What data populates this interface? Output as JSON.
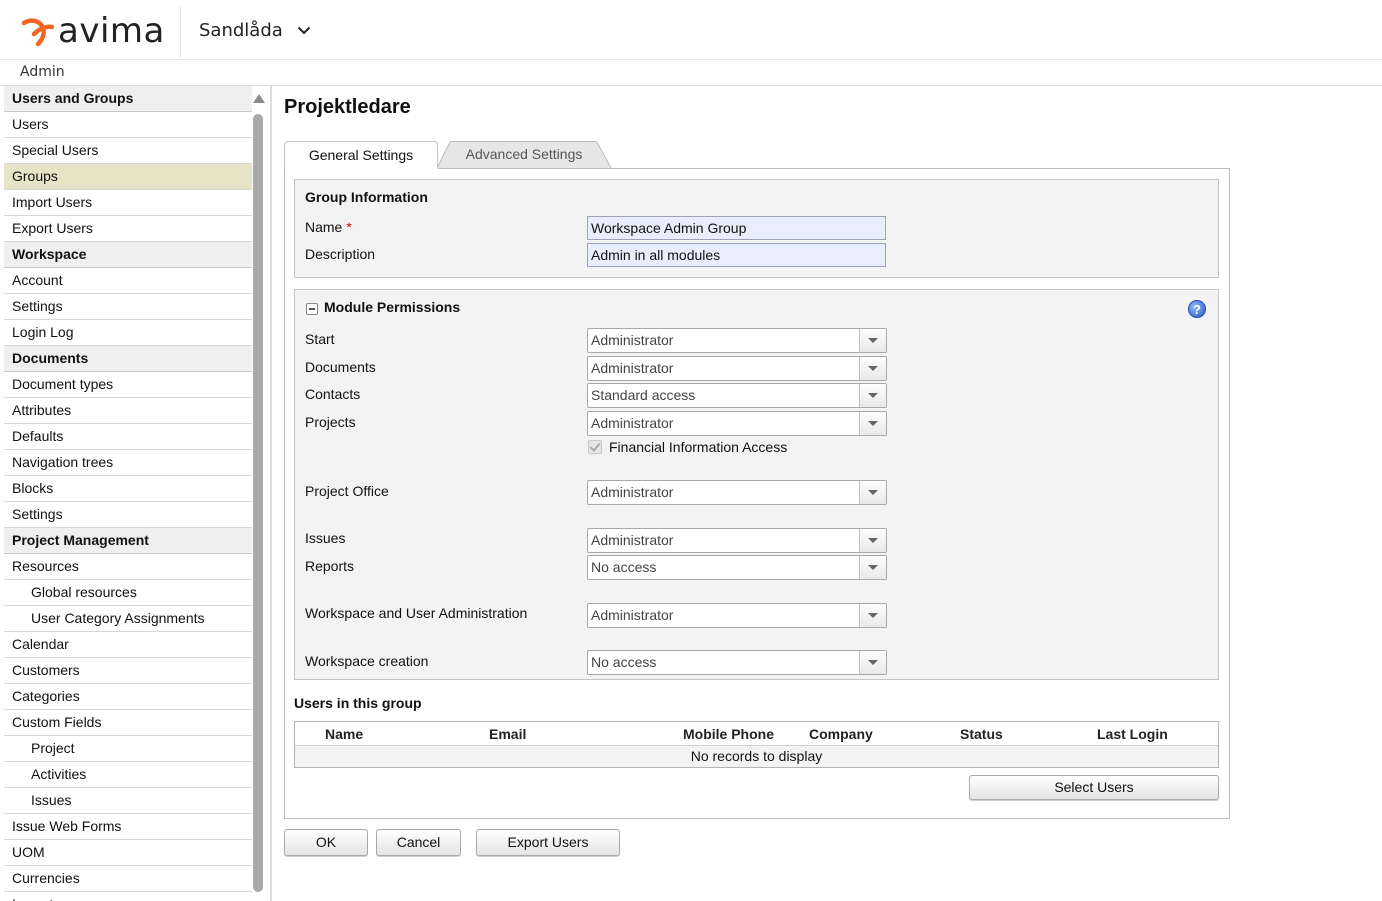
{
  "header": {
    "brand": "avima",
    "workspace": "Sandlåda",
    "breadcrumb": "Admin"
  },
  "sidebar": {
    "items": [
      {
        "label": "Users and Groups",
        "type": "header"
      },
      {
        "label": "Users",
        "type": "item"
      },
      {
        "label": "Special Users",
        "type": "item"
      },
      {
        "label": "Groups",
        "type": "item",
        "active": true
      },
      {
        "label": "Import Users",
        "type": "item"
      },
      {
        "label": "Export Users",
        "type": "item"
      },
      {
        "label": "Workspace",
        "type": "header"
      },
      {
        "label": "Account",
        "type": "item"
      },
      {
        "label": "Settings",
        "type": "item"
      },
      {
        "label": "Login Log",
        "type": "item"
      },
      {
        "label": "Documents",
        "type": "header"
      },
      {
        "label": "Document types",
        "type": "item"
      },
      {
        "label": "Attributes",
        "type": "item"
      },
      {
        "label": "Defaults",
        "type": "item"
      },
      {
        "label": "Navigation trees",
        "type": "item"
      },
      {
        "label": "Blocks",
        "type": "item"
      },
      {
        "label": "Settings",
        "type": "item"
      },
      {
        "label": "Project Management",
        "type": "header"
      },
      {
        "label": "Resources",
        "type": "item"
      },
      {
        "label": "Global resources",
        "type": "sub"
      },
      {
        "label": "User Category Assignments",
        "type": "sub"
      },
      {
        "label": "Calendar",
        "type": "item"
      },
      {
        "label": "Customers",
        "type": "item"
      },
      {
        "label": "Categories",
        "type": "item"
      },
      {
        "label": "Custom Fields",
        "type": "item"
      },
      {
        "label": "Project",
        "type": "sub"
      },
      {
        "label": "Activities",
        "type": "sub"
      },
      {
        "label": "Issues",
        "type": "sub"
      },
      {
        "label": "Issue Web Forms",
        "type": "item"
      },
      {
        "label": "UOM",
        "type": "item"
      },
      {
        "label": "Currencies",
        "type": "item"
      },
      {
        "label": "Issue types",
        "type": "item"
      }
    ]
  },
  "page": {
    "title": "Projektledare",
    "tabs": {
      "general": "General Settings",
      "advanced": "Advanced Settings"
    }
  },
  "group_info": {
    "title": "Group Information",
    "name_label": "Name",
    "required_mark": "*",
    "name_value": "Workspace Admin Group",
    "description_label": "Description",
    "description_value": "Admin in all modules"
  },
  "permissions": {
    "title": "Module Permissions",
    "help_glyph": "?",
    "rows": [
      {
        "label": "Start",
        "value": "Administrator"
      },
      {
        "label": "Documents",
        "value": "Administrator"
      },
      {
        "label": "Contacts",
        "value": "Standard access"
      },
      {
        "label": "Projects",
        "value": "Administrator"
      },
      {
        "label": "Project Office",
        "value": "Administrator"
      },
      {
        "label": "Issues",
        "value": "Administrator"
      },
      {
        "label": "Reports",
        "value": "No access"
      },
      {
        "label": "Workspace and User Administration",
        "value": "Administrator"
      },
      {
        "label": "Workspace creation",
        "value": "No access"
      }
    ],
    "financial_checkbox_label": "Financial Information Access",
    "financial_checked": true
  },
  "users_grid": {
    "title": "Users in this group",
    "columns": [
      "Name",
      "Email",
      "Mobile Phone",
      "Company",
      "Status",
      "Last Login"
    ],
    "empty_text": "No records to display",
    "select_button": "Select Users"
  },
  "footer_buttons": {
    "ok": "OK",
    "cancel": "Cancel",
    "export": "Export Users"
  },
  "colors": {
    "brand_accent": "#f26522",
    "active_sidebar": "#e6e4c6",
    "input_bg": "#e8eefc"
  }
}
